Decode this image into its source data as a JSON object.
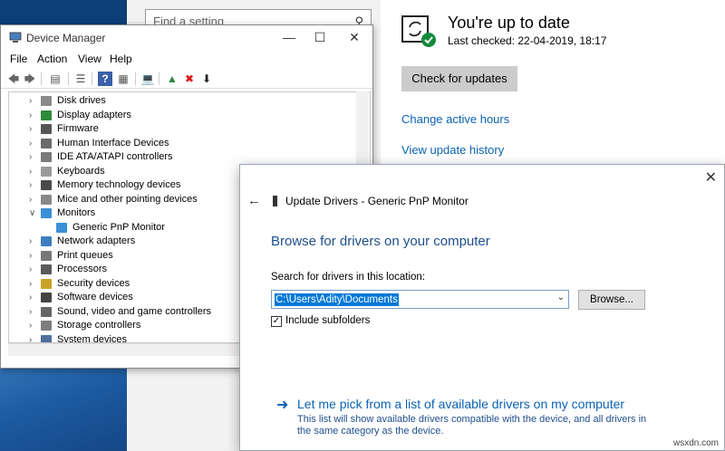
{
  "settings": {
    "search_placeholder": "Find a setting",
    "status_title": "You're up to date",
    "last_checked": "Last checked: 22-04-2019, 18:17",
    "check_button": "Check for updates",
    "links": [
      "Change active hours",
      "View update history"
    ]
  },
  "device_manager": {
    "title": "Device Manager",
    "menu": [
      "File",
      "Action",
      "View",
      "Help"
    ],
    "tree": [
      {
        "label": "Disk drives",
        "expanded": false,
        "color": "#8a8a8a"
      },
      {
        "label": "Display adapters",
        "expanded": false,
        "color": "#2e8b3a"
      },
      {
        "label": "Firmware",
        "expanded": false,
        "color": "#555555"
      },
      {
        "label": "Human Interface Devices",
        "expanded": false,
        "color": "#6b6b6b"
      },
      {
        "label": "IDE ATA/ATAPI controllers",
        "expanded": false,
        "color": "#7a7a7a"
      },
      {
        "label": "Keyboards",
        "expanded": false,
        "color": "#9a9a9a"
      },
      {
        "label": "Memory technology devices",
        "expanded": false,
        "color": "#4a4a4a"
      },
      {
        "label": "Mice and other pointing devices",
        "expanded": false,
        "color": "#888888"
      },
      {
        "label": "Monitors",
        "expanded": true,
        "color": "#3a8fd6"
      },
      {
        "label": "Generic PnP Monitor",
        "child": true,
        "color": "#3a8fd6"
      },
      {
        "label": "Network adapters",
        "expanded": false,
        "color": "#3c7fbf"
      },
      {
        "label": "Print queues",
        "expanded": false,
        "color": "#777777"
      },
      {
        "label": "Processors",
        "expanded": false,
        "color": "#5a5a5a"
      },
      {
        "label": "Security devices",
        "expanded": false,
        "color": "#c9a227"
      },
      {
        "label": "Software devices",
        "expanded": false,
        "color": "#444444"
      },
      {
        "label": "Sound, video and game controllers",
        "expanded": false,
        "color": "#666666"
      },
      {
        "label": "Storage controllers",
        "expanded": false,
        "color": "#7d7d7d"
      },
      {
        "label": "System devices",
        "expanded": false,
        "color": "#4e6e9e"
      }
    ]
  },
  "update_dialog": {
    "title": "Update Drivers - Generic PnP Monitor",
    "heading": "Browse for drivers on your computer",
    "search_label": "Search for drivers in this location:",
    "path_value": "C:\\Users\\Adity\\Documents",
    "browse_button": "Browse...",
    "include_subfolders": "Include subfolders",
    "include_checked": true,
    "pick_link": "Let me pick from a list of available drivers on my computer",
    "pick_desc": "This list will show available drivers compatible with the device, and all drivers in the same category as the device."
  },
  "watermark": "wsxdn.com"
}
